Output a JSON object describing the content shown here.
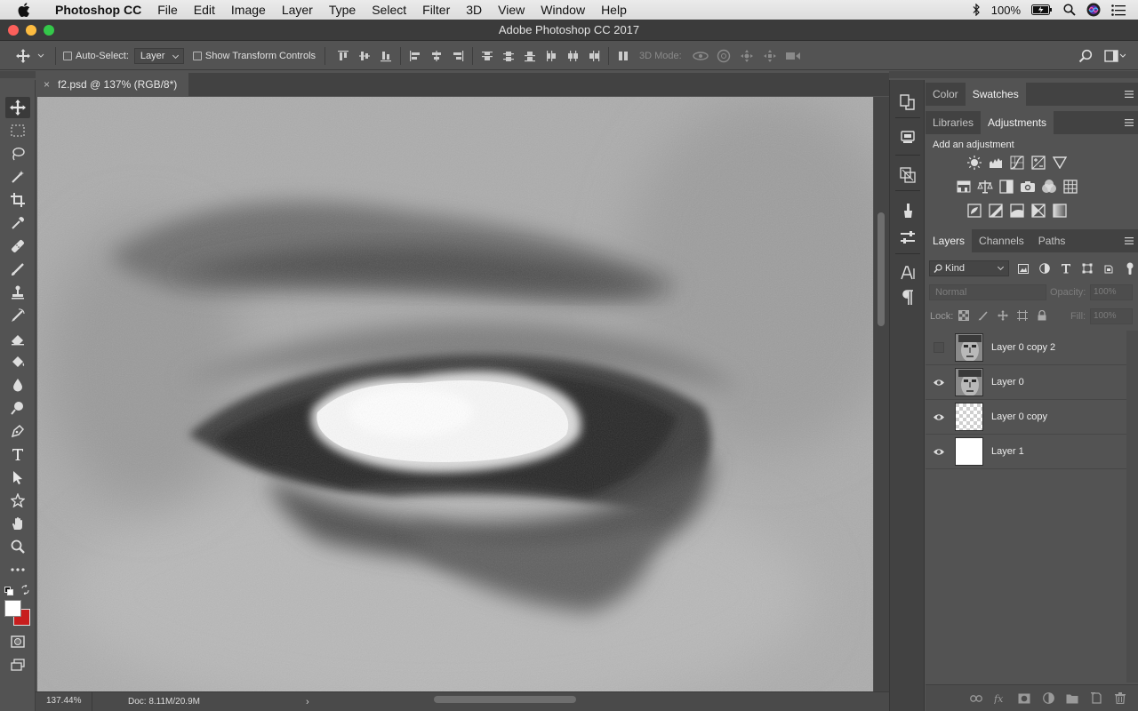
{
  "menubar": {
    "apple_icon": "apple-logo",
    "items": [
      "Photoshop CC",
      "File",
      "Edit",
      "Image",
      "Layer",
      "Type",
      "Select",
      "Filter",
      "3D",
      "View",
      "Window",
      "Help"
    ],
    "battery_percent": "100%",
    "status_icons": [
      "bluetooth-icon",
      "battery-icon",
      "search-icon",
      "siri-icon",
      "list-icon"
    ]
  },
  "window": {
    "title": "Adobe Photoshop CC 2017"
  },
  "options": {
    "auto_select_label": "Auto-Select:",
    "auto_select_value": "Layer",
    "show_transform_label": "Show Transform Controls",
    "mode_3d_label": "3D Mode:"
  },
  "document": {
    "tab_label": "f2.psd @ 137% (RGB/8*)",
    "close_glyph": "×",
    "zoom": "137.44%",
    "doc_size": "Doc: 8.11M/20.9M",
    "status_arrow": "›"
  },
  "panels": {
    "top_tabs": [
      "Color",
      "Swatches"
    ],
    "top_active": "Swatches",
    "mid_tabs": [
      "Libraries",
      "Adjustments"
    ],
    "mid_active": "Adjustments",
    "adjust_title": "Add an adjustment",
    "layers_tabs": [
      "Layers",
      "Channels",
      "Paths"
    ],
    "layers_active": "Layers",
    "filter_kind": "Kind",
    "blend_mode": "Normal",
    "opacity_label": "Opacity:",
    "opacity_value": "100%",
    "lock_label": "Lock:",
    "fill_label": "Fill:",
    "fill_value": "100%"
  },
  "layers": [
    {
      "name": "Layer 0 copy 2",
      "visible": false,
      "thumb": "face"
    },
    {
      "name": "Layer 0",
      "visible": true,
      "thumb": "face"
    },
    {
      "name": "Layer 0 copy",
      "visible": true,
      "thumb": "transparent"
    },
    {
      "name": "Layer 1",
      "visible": true,
      "thumb": "white"
    }
  ],
  "colors": {
    "foreground": "#ffffff",
    "background": "#c81e1e",
    "panel_bg": "#535353",
    "dark_bg": "#424242"
  }
}
